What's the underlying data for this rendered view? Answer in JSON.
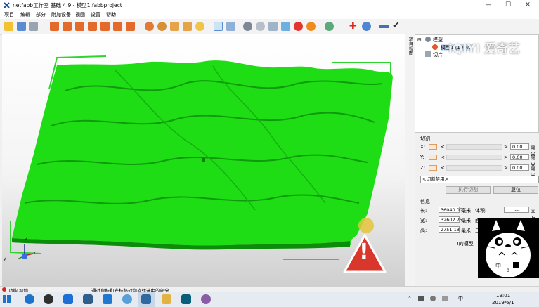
{
  "window": {
    "title": "netfabb工作室 基础 4.9 - 模型1.fabbproject",
    "minimize": "—",
    "maximize": "☐",
    "close": "✕"
  },
  "menu": [
    "项目",
    "编辑",
    "部分",
    "附加设备",
    "视图",
    "设置",
    "帮助"
  ],
  "toolbar": {
    "icons": [
      "open-folder-icon",
      "import-icon",
      "save-icon",
      "view-front-icon",
      "view-back-icon",
      "view-left-icon",
      "view-right-icon",
      "view-top-icon",
      "view-bottom-icon",
      "rotate-icon",
      "pan-icon",
      "zoom-fit-icon",
      "zoom-icon",
      "select-icon",
      "measure-icon",
      "add-part-icon",
      "repair-icon",
      "analysis-icon",
      "color-icon",
      "shading-icon",
      "texture-icon",
      "add-icon",
      "options-icon",
      "minus-icon",
      "check-icon"
    ]
  },
  "viewport": {
    "terrain_color": "#1fdd14",
    "bbox_color": "#2fd52f",
    "axis": {
      "z": "z",
      "x": "x",
      "y": "y"
    }
  },
  "side_tab": "项目视图",
  "tree": {
    "root": "模型",
    "part": "模型1 (100%)",
    "slices": "切片"
  },
  "cut": {
    "title": "切割",
    "rows": [
      {
        "axis": "X:",
        "value": "0.00",
        "unit": "毫米"
      },
      {
        "axis": "Y:",
        "value": "0.00",
        "unit": "毫米"
      },
      {
        "axis": "Z:",
        "value": "0.00",
        "unit": "毫米"
      }
    ],
    "arrow_left": "<",
    "arrow_right": ">",
    "mode": "<切割禁用>",
    "execute": "执行切割",
    "reset": "复位"
  },
  "info": {
    "title": "信息",
    "length_label": "长:",
    "length": "36040.00",
    "width_label": "宽:",
    "width": "32602.75",
    "height_label": "高:",
    "height": "2751.13",
    "unit": "毫米",
    "volume_label": "体积:",
    "volume": "---",
    "volume_unit": "立方",
    "area_label": "面积:",
    "triangles_label": "三角",
    "model_text": "!的模型"
  },
  "status": {
    "left": "功能 初始",
    "middle": "通过鼠标和光标移动和旋转选中的部分"
  },
  "taskbar": {
    "time": "19:01",
    "date": "2019/6/1",
    "ime": "中",
    "apps": [
      "#1e73c8",
      "#2f2f2f",
      "#1d6fd6",
      "#2e5e8c",
      "#1f77d0",
      "#5aa0d8",
      "#2e6aa0",
      "#e3b341",
      "#0a5e7a",
      "#8a5ca5"
    ]
  },
  "watermark": "iQIYI 爱奇艺",
  "warning_symbol": "!",
  "totoro": {
    "ime": "中",
    "num": "0"
  }
}
